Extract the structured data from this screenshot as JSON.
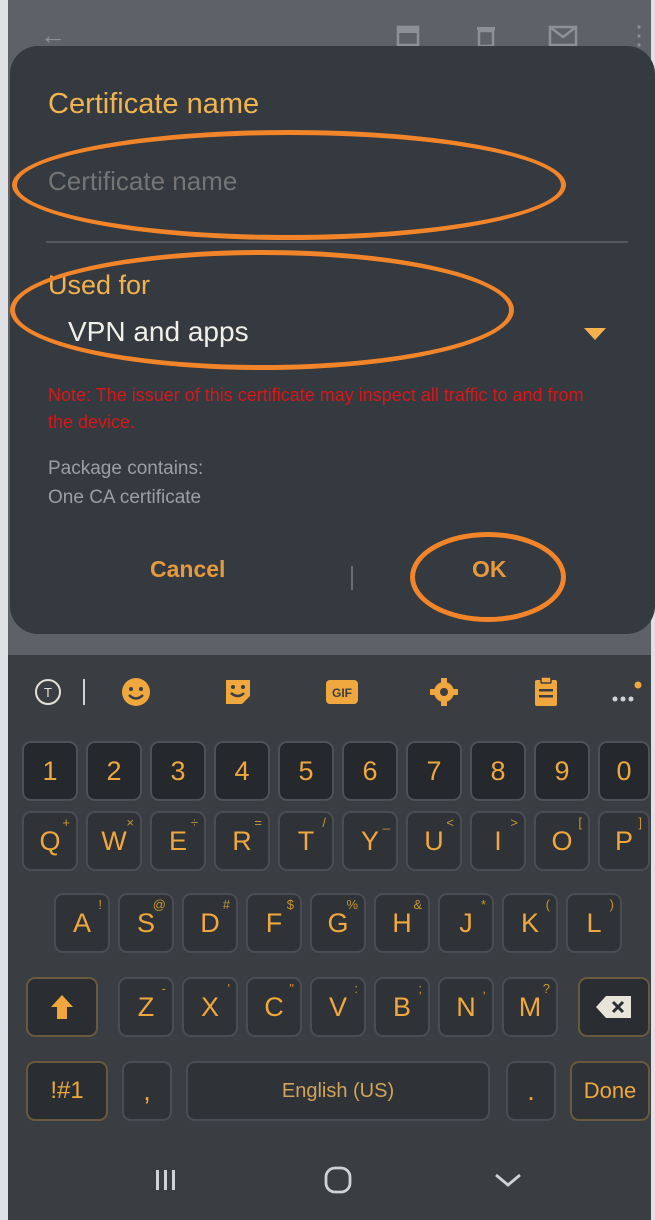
{
  "dialog": {
    "title": "Certificate name",
    "name_placeholder": "Certificate name",
    "name_value": "",
    "used_for_label": "Used for",
    "used_for_value": "VPN and apps",
    "note": "Note: The issuer of this certificate may inspect all traffic to and from the device.",
    "package_line1": "Package contains:",
    "package_line2": "One CA certificate",
    "cancel_label": "Cancel",
    "ok_label": "OK"
  },
  "background_toolbar": {
    "icons": [
      "back-arrow-icon",
      "archive-icon",
      "delete-icon",
      "mail-icon",
      "more-vert-icon"
    ]
  },
  "keyboard": {
    "toolbar": [
      "translate-icon",
      "emoji-icon",
      "sticker-icon",
      "gif-icon",
      "settings-icon",
      "clipboard-icon",
      "more-icon"
    ],
    "gif_label": "GIF",
    "number_row": [
      "1",
      "2",
      "3",
      "4",
      "5",
      "6",
      "7",
      "8",
      "9",
      "0"
    ],
    "row1": [
      {
        "key": "Q",
        "sec": "+"
      },
      {
        "key": "W",
        "sec": "×"
      },
      {
        "key": "E",
        "sec": "÷"
      },
      {
        "key": "R",
        "sec": "="
      },
      {
        "key": "T",
        "sec": "/"
      },
      {
        "key": "Y",
        "sec": "_"
      },
      {
        "key": "U",
        "sec": "<"
      },
      {
        "key": "I",
        "sec": ">"
      },
      {
        "key": "O",
        "sec": "["
      },
      {
        "key": "P",
        "sec": "]"
      }
    ],
    "row2": [
      {
        "key": "A",
        "sec": "!"
      },
      {
        "key": "S",
        "sec": "@"
      },
      {
        "key": "D",
        "sec": "#"
      },
      {
        "key": "F",
        "sec": "$"
      },
      {
        "key": "G",
        "sec": "%"
      },
      {
        "key": "H",
        "sec": "&"
      },
      {
        "key": "J",
        "sec": "*"
      },
      {
        "key": "K",
        "sec": "("
      },
      {
        "key": "L",
        "sec": ")"
      }
    ],
    "row3": [
      {
        "key": "Z",
        "sec": "-"
      },
      {
        "key": "X",
        "sec": "'"
      },
      {
        "key": "C",
        "sec": "\""
      },
      {
        "key": "V",
        "sec": ":"
      },
      {
        "key": "B",
        "sec": ";"
      },
      {
        "key": "N",
        "sec": ","
      },
      {
        "key": "M",
        "sec": "?"
      }
    ],
    "symbols_label": "!#1",
    "comma_label": ",",
    "space_label": "English (US)",
    "period_label": ".",
    "done_label": "Done"
  },
  "navbar": {
    "icons": [
      "recent-apps-icon",
      "home-icon",
      "back-icon"
    ]
  },
  "colors": {
    "accent": "#f0a83e",
    "annotation": "#f2852a",
    "warning": "#d81818",
    "dialog_bg": "#353940"
  }
}
